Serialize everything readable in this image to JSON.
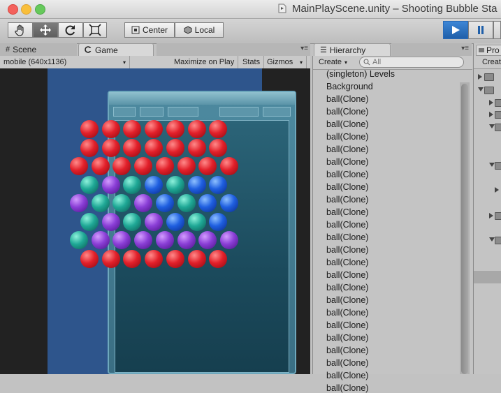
{
  "window": {
    "title": "MainPlayScene.unity – Shooting Bubble Sta"
  },
  "toolbar": {
    "pivot_label": "Center",
    "space_label": "Local"
  },
  "tabs": {
    "scene": "Scene",
    "game": "Game",
    "hierarchy": "Hierarchy",
    "project": "Pro"
  },
  "game_toolbar": {
    "resolution": "mobile (640x1136)",
    "maximize": "Maximize on Play",
    "stats": "Stats",
    "gizmos": "Gizmos"
  },
  "hierarchy": {
    "create_label": "Create",
    "search_placeholder": "All",
    "items": [
      "(singleton) Levels",
      "Background",
      "ball(Clone)",
      "ball(Clone)",
      "ball(Clone)",
      "ball(Clone)",
      "ball(Clone)",
      "ball(Clone)",
      "ball(Clone)",
      "ball(Clone)",
      "ball(Clone)",
      "ball(Clone)",
      "ball(Clone)",
      "ball(Clone)",
      "ball(Clone)",
      "ball(Clone)",
      "ball(Clone)",
      "ball(Clone)",
      "ball(Clone)",
      "ball(Clone)",
      "ball(Clone)",
      "ball(Clone)",
      "ball(Clone)",
      "ball(Clone)",
      "ball(Clone)",
      "ball(Clone)"
    ]
  },
  "project": {
    "create_label": "Creat"
  },
  "game_board": {
    "rows": [
      [
        "red",
        "red",
        "red",
        "red",
        "red",
        "red",
        "red"
      ],
      [
        "red",
        "red",
        "red",
        "red",
        "red",
        "red",
        "red"
      ],
      [
        "red",
        "red",
        "red",
        "red",
        "red",
        "red",
        "red",
        "red"
      ],
      [
        "teal",
        "purple",
        "teal",
        "blue",
        "teal",
        "blue",
        "blue"
      ],
      [
        "purple",
        "teal",
        "teal",
        "purple",
        "blue",
        "teal",
        "blue",
        "blue"
      ],
      [
        "teal",
        "purple",
        "teal",
        "purple",
        "blue",
        "teal",
        "blue"
      ],
      [
        "teal",
        "purple",
        "purple",
        "purple",
        "purple",
        "purple",
        "purple",
        "purple"
      ],
      [
        "red",
        "red",
        "red",
        "red",
        "red",
        "red",
        "red"
      ]
    ]
  }
}
